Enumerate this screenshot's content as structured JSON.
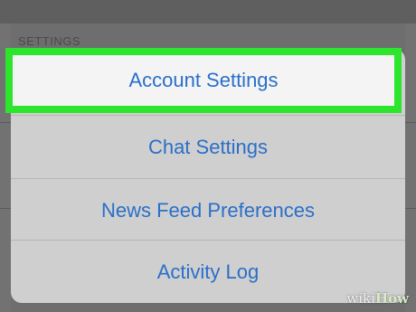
{
  "background": {
    "section_label": "SETTINGS"
  },
  "menu": {
    "items": [
      {
        "label": "Account Settings",
        "highlighted": true
      },
      {
        "label": "Chat Settings"
      },
      {
        "label": "News Feed Preferences"
      },
      {
        "label": "Activity Log"
      }
    ],
    "colors": {
      "link": "#2a6fc9",
      "highlight_border": "#2ee52e",
      "sheet": "#cfcfcf",
      "highlight_fill": "#f4f4f4"
    }
  },
  "watermark": {
    "wiki": "wiki",
    "how": "How"
  }
}
